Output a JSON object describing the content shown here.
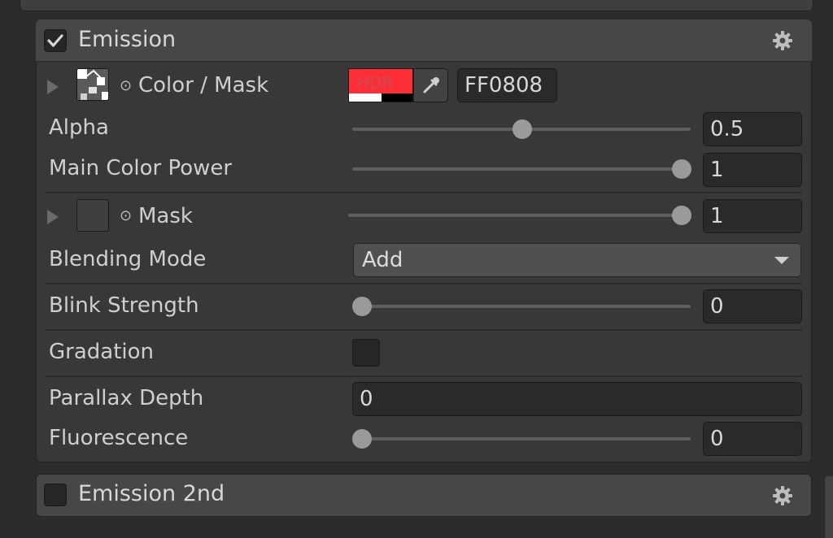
{
  "emission": {
    "title": "Emission",
    "enabled": true,
    "color_mask": {
      "label": "Color / Mask",
      "hdr_label": "HDR",
      "color_hex": "FF0808",
      "swatch_color": "#ff2d36"
    },
    "alpha": {
      "label": "Alpha",
      "value": "0.5",
      "fraction": 0.5
    },
    "main_color_power": {
      "label": "Main Color Power",
      "value": "1",
      "fraction": 1.0
    },
    "mask": {
      "label": "Mask",
      "value": "1",
      "fraction": 1.0
    },
    "blending_mode": {
      "label": "Blending Mode",
      "selected": "Add"
    },
    "blink_strength": {
      "label": "Blink Strength",
      "value": "0",
      "fraction": 0.0
    },
    "gradation": {
      "label": "Gradation",
      "checked": false
    },
    "parallax_depth": {
      "label": "Parallax Depth",
      "value": "0"
    },
    "fluorescence": {
      "label": "Fluorescence",
      "value": "0",
      "fraction": 0.0
    }
  },
  "emission_2nd": {
    "title": "Emission 2nd",
    "enabled": false
  },
  "icons": {
    "settings": "gear-icon",
    "eyedropper": "eyedropper-icon",
    "foldout": "triangle-right-icon",
    "target": "object-picker-icon"
  }
}
